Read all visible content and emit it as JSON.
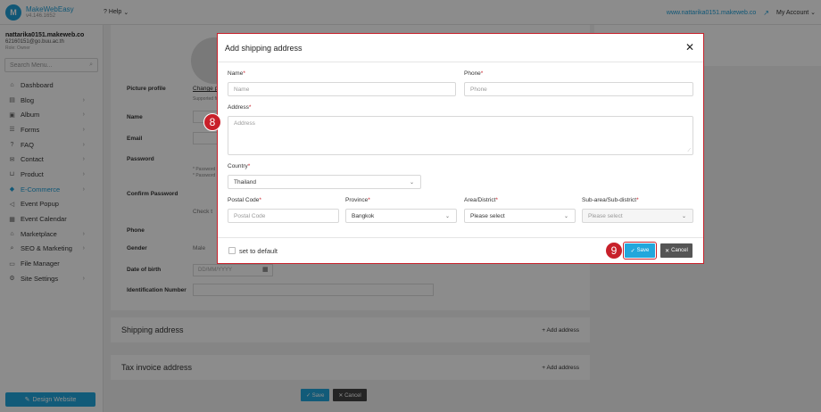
{
  "brand": {
    "name": "MakeWebEasy",
    "version": "v4.146.1652",
    "logo_glyph": "M",
    "color": "#1f9fd7"
  },
  "topbar": {
    "help": "Help",
    "site_link": "www.nattarika0151.makeweb.co",
    "account": "My Account"
  },
  "sidebar": {
    "site_name": "nattarika0151.makeweb.co",
    "email": "62160151@go.buu.ac.th",
    "role": "Role: Owner",
    "search_placeholder": "Search Menu...",
    "items": [
      {
        "label": "Dashboard",
        "icon": "home-icon"
      },
      {
        "label": "Blog",
        "icon": "document-icon"
      },
      {
        "label": "Album",
        "icon": "image-icon"
      },
      {
        "label": "Forms",
        "icon": "list-icon"
      },
      {
        "label": "FAQ",
        "icon": "faq-icon"
      },
      {
        "label": "Contact",
        "icon": "mail-icon"
      },
      {
        "label": "Product",
        "icon": "cart-icon"
      },
      {
        "label": "E-Commerce",
        "icon": "tag-icon"
      },
      {
        "label": "Event Popup",
        "icon": "megaphone-icon"
      },
      {
        "label": "Event Calendar",
        "icon": "calendar-icon"
      },
      {
        "label": "Marketplace",
        "icon": "shop-icon"
      },
      {
        "label": "SEO & Marketing",
        "icon": "search-icon"
      },
      {
        "label": "File Manager",
        "icon": "folder-icon"
      },
      {
        "label": "Site Settings",
        "icon": "gear-icon"
      }
    ],
    "active_item": "E-Commerce",
    "design_button": "Design Website"
  },
  "background_page": {
    "picture_profile": "Picture profile",
    "change_picture": "Change pict",
    "supported": "Supported fil",
    "name": "Name",
    "email": "Email",
    "password": "Password",
    "password_hint_1": "* Password m",
    "password_hint_2": "* Password m",
    "confirm_password": "Confirm Password",
    "check": "Check t",
    "phone": "Phone",
    "gender": "Gender",
    "male": "Male",
    "dob": "Date of birth",
    "dob_placeholder": "DD/MM/YYYY",
    "id_number": "Identification Number",
    "shipping_title": "Shipping address",
    "tax_title": "Tax invoice address",
    "add_address": "+ Add address",
    "save": "✓ Save",
    "cancel": "✕ Cancel"
  },
  "modal": {
    "title": "Add shipping address",
    "name_label": "Name",
    "name_placeholder": "Name",
    "phone_label": "Phone",
    "phone_placeholder": "Phone",
    "address_label": "Address",
    "address_placeholder": "Address",
    "country_label": "Country",
    "country_value": "Thailand",
    "postal_label": "Postal Code",
    "postal_placeholder": "Postal Code",
    "province_label": "Province",
    "province_value": "Bangkok",
    "area_label": "Area/District",
    "area_value": "Please select",
    "subarea_label": "Sub-area/Sub-district",
    "subarea_value": "Please select",
    "required_mark": "*",
    "set_default": "set to default",
    "save": "Save",
    "cancel": "Cancel"
  },
  "steps": {
    "step8": "8",
    "step9": "9"
  },
  "colors": {
    "accent": "#22a7dc",
    "highlight": "#c8202a"
  }
}
